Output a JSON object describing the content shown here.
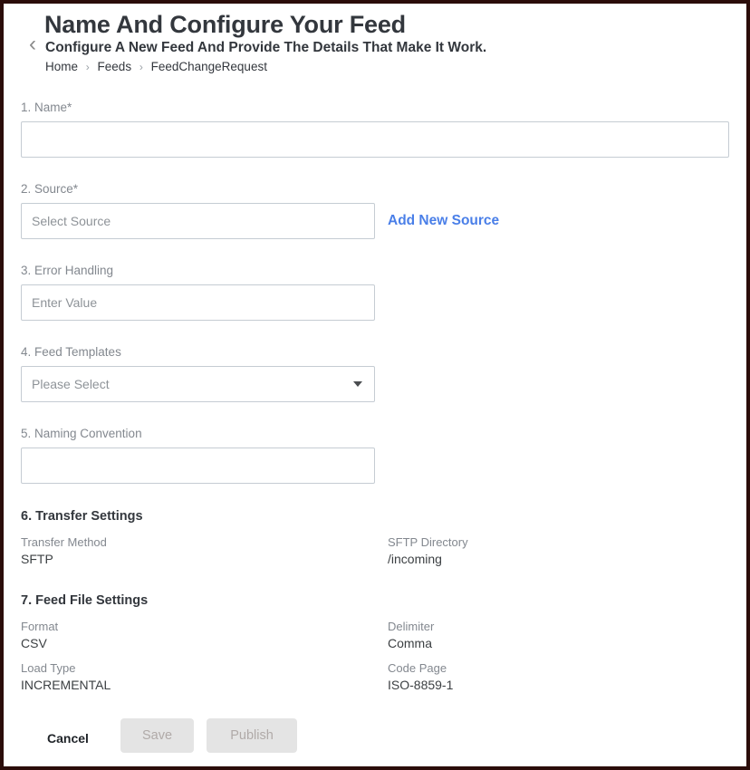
{
  "header": {
    "back_icon": "chevron-left-icon",
    "title": "Name And Configure Your Feed",
    "subtitle": "Configure A New Feed And Provide The Details That Make It Work.",
    "breadcrumb": [
      {
        "label": "Home"
      },
      {
        "label": "Feeds"
      },
      {
        "label": "FeedChangeRequest"
      }
    ],
    "breadcrumb_separator": "›"
  },
  "form": {
    "name": {
      "label": "1. Name*",
      "value": "",
      "placeholder": ""
    },
    "source": {
      "label": "2. Source*",
      "value": "",
      "placeholder": "Select Source",
      "add_new_link": "Add New Source"
    },
    "error_handling": {
      "label": "3. Error Handling",
      "value": "",
      "placeholder": "Enter Value"
    },
    "feed_templates": {
      "label": "4. Feed Templates",
      "selected": "Please Select",
      "dropdown_icon": "chevron-down-icon"
    },
    "naming_convention": {
      "label": "5. Naming Convention",
      "value": "",
      "placeholder": ""
    },
    "transfer_settings": {
      "title": "6. Transfer Settings",
      "items": [
        {
          "label": "Transfer Method",
          "value": "SFTP"
        },
        {
          "label": "SFTP Directory",
          "value": "/incoming"
        }
      ]
    },
    "feed_file_settings": {
      "title": "7. Feed File Settings",
      "items": [
        {
          "label": "Format",
          "value": "CSV"
        },
        {
          "label": "Delimiter",
          "value": "Comma"
        },
        {
          "label": "Load Type",
          "value": "INCREMENTAL"
        },
        {
          "label": "Code Page",
          "value": "ISO-8859-1"
        }
      ]
    }
  },
  "footer": {
    "cancel_label": "Cancel",
    "save_label": "Save",
    "publish_label": "Publish"
  },
  "colors": {
    "link": "#4a7fe8",
    "heading": "#33373d",
    "label": "#83888f",
    "value": "#3c4043",
    "input_border": "#c5ccd3",
    "disabled_button_bg": "#e4e4e4",
    "page_border": "#2b0d0a"
  }
}
